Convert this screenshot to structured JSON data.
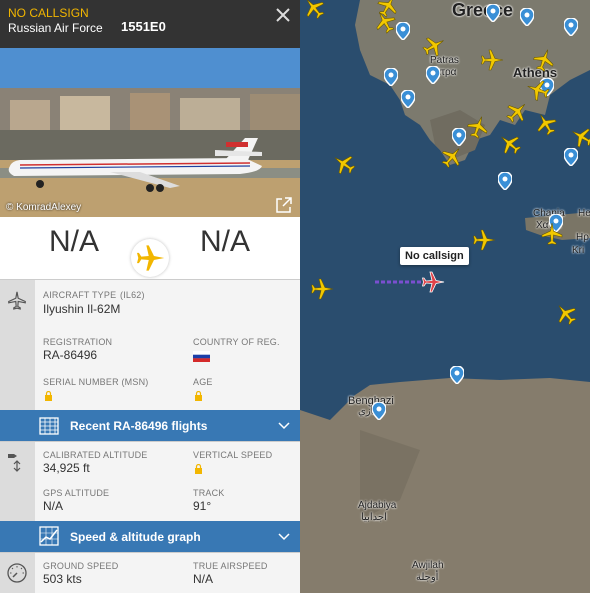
{
  "header": {
    "callsign": "NO CALLSIGN",
    "operator": "Russian Air Force",
    "hex": "1551E0"
  },
  "photo": {
    "credit": "© KomradAlexey"
  },
  "route": {
    "origin": "N/A",
    "destination": "N/A"
  },
  "aircraft": {
    "type_label": "AIRCRAFT TYPE",
    "type_code": "(IL62)",
    "type_name": "Ilyushin Il-62M",
    "registration_label": "REGISTRATION",
    "registration": "RA-86496",
    "country_label": "COUNTRY OF REG.",
    "serial_label": "SERIAL NUMBER (MSN)",
    "age_label": "AGE"
  },
  "recent_flights": {
    "title": "Recent RA-86496 flights"
  },
  "altitude": {
    "calibrated_label": "CALIBRATED ALTITUDE",
    "calibrated": "34,925 ft",
    "vertical_speed_label": "VERTICAL SPEED",
    "gps_label": "GPS ALTITUDE",
    "gps": "N/A",
    "track_label": "TRACK",
    "track": "91°"
  },
  "graph": {
    "title": "Speed & altitude graph"
  },
  "speed": {
    "ground_label": "GROUND SPEED",
    "ground": "503 kts",
    "true_label": "TRUE AIRSPEED",
    "true": "N/A"
  },
  "map": {
    "callout": "No callsign",
    "places": {
      "greece": "Greece",
      "patras": "Patras",
      "patras_local": "Πάτρα",
      "athens": "Athens",
      "chania": "Chania",
      "chania_local": "Χανιά",
      "her": "He",
      "her2": "Ηρ",
      "kri": "Kri",
      "benghazi": "Benghazi",
      "benghazi_local": "بنغازي",
      "ajdabiya": "Ajdabiya",
      "ajdabiya_local": "اجدابيا",
      "awjilah": "Awjilah",
      "awjilah_local": "أوجلة"
    }
  },
  "colors": {
    "accent_yellow": "#f2b600",
    "bar_blue": "#3878b4",
    "selected_plane": "#e0434a",
    "sea": "#2a4d6e",
    "land": "#807a70"
  }
}
